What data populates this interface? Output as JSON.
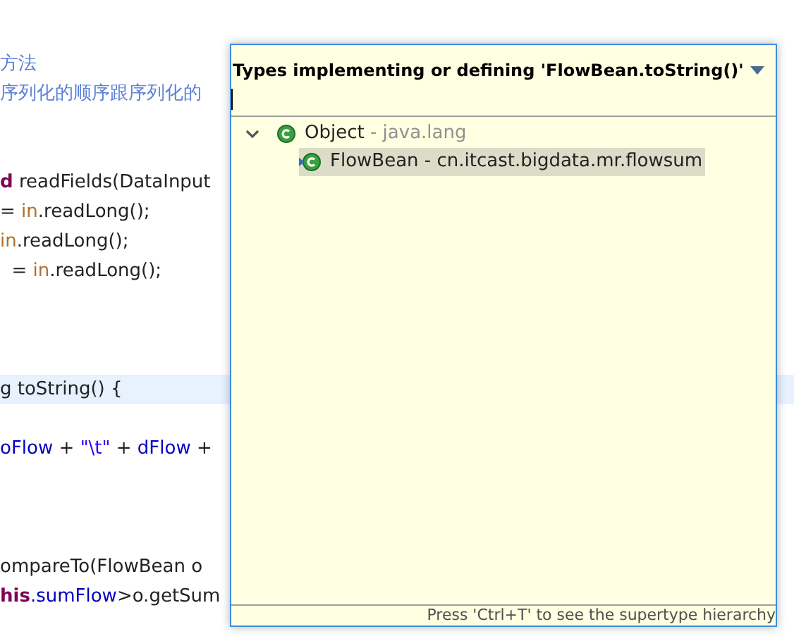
{
  "editor": {
    "lines": [
      {
        "kind": "code",
        "segments": [
          {
            "kind": "comment",
            "text": "方法"
          }
        ]
      },
      {
        "kind": "code",
        "segments": [
          {
            "kind": "comment",
            "text": "序列化的顺序跟序列化的"
          }
        ]
      },
      {
        "kind": "blank"
      },
      {
        "kind": "blank"
      },
      {
        "kind": "code",
        "segments": [
          {
            "kind": "keyword",
            "text": "d"
          },
          {
            "kind": "plain",
            "text": " readFields(DataInput"
          }
        ]
      },
      {
        "kind": "code",
        "segments": [
          {
            "kind": "plain",
            "text": "= "
          },
          {
            "kind": "param",
            "text": "in"
          },
          {
            "kind": "plain",
            "text": ".readLong();"
          }
        ]
      },
      {
        "kind": "code",
        "segments": [
          {
            "kind": "param",
            "text": "in"
          },
          {
            "kind": "plain",
            "text": ".readLong();"
          }
        ]
      },
      {
        "kind": "code",
        "segments": [
          {
            "kind": "plain",
            "text": "  = "
          },
          {
            "kind": "param",
            "text": "in"
          },
          {
            "kind": "plain",
            "text": ".readLong();"
          }
        ]
      },
      {
        "kind": "blank"
      },
      {
        "kind": "blank"
      },
      {
        "kind": "blank"
      },
      {
        "kind": "code",
        "current": true,
        "segments": [
          {
            "kind": "plain",
            "text": "g toString() {"
          }
        ]
      },
      {
        "kind": "blank"
      },
      {
        "kind": "code",
        "segments": [
          {
            "kind": "field",
            "text": "oFlow"
          },
          {
            "kind": "plain",
            "text": " + "
          },
          {
            "kind": "string",
            "text": "\"\\t\""
          },
          {
            "kind": "plain",
            "text": " + "
          },
          {
            "kind": "field",
            "text": "dFlow"
          },
          {
            "kind": "plain",
            "text": " +"
          }
        ]
      },
      {
        "kind": "blank"
      },
      {
        "kind": "blank"
      },
      {
        "kind": "blank"
      },
      {
        "kind": "code",
        "segments": [
          {
            "kind": "plain",
            "text": "ompareTo(FlowBean o"
          }
        ]
      },
      {
        "kind": "code",
        "segments": [
          {
            "kind": "keyword",
            "text": "his"
          },
          {
            "kind": "field",
            "text": ".sumFlow"
          },
          {
            "kind": "plain",
            "text": ">o.getSum"
          }
        ]
      }
    ]
  },
  "popup": {
    "title": "Types implementing or defining 'FlowBean.toString()'",
    "tree": [
      {
        "name": "Object",
        "qualifier": " - java.lang",
        "expanded": true,
        "selected": false,
        "children": [
          {
            "name": "FlowBean - cn.itcast.bigdata.mr.flowsum",
            "selected": true,
            "override": true
          }
        ]
      }
    ],
    "footer": "Press 'Ctrl+T' to see the supertype hierarchy"
  }
}
